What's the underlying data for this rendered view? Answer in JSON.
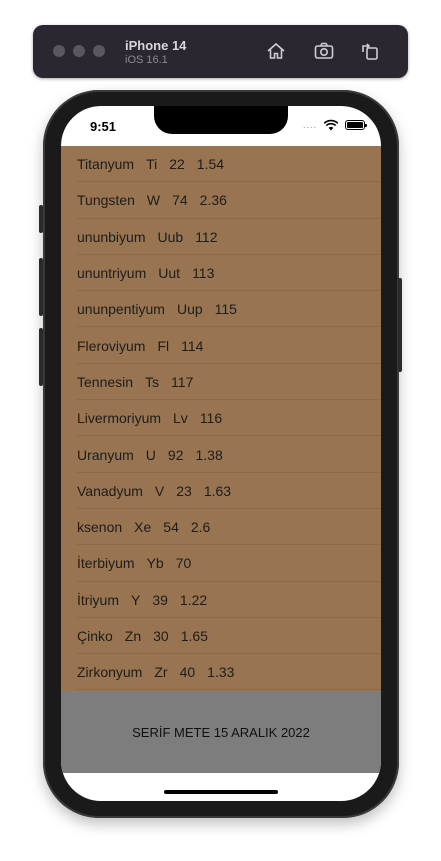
{
  "simulator": {
    "device_name": "iPhone 14",
    "os_version": "iOS 16.1",
    "icons": [
      "home-icon",
      "screenshot-icon",
      "rotate-icon"
    ]
  },
  "status_bar": {
    "time": "9:51",
    "signal_dots": "....",
    "icons": [
      "wifi-icon",
      "battery-icon"
    ]
  },
  "elements": [
    {
      "name": "Titanyum",
      "symbol": "Ti",
      "number": "22",
      "value": "1.54"
    },
    {
      "name": "Tungsten",
      "symbol": "W",
      "number": "74",
      "value": "2.36"
    },
    {
      "name": "ununbiyum",
      "symbol": "Uub",
      "number": "112",
      "value": ""
    },
    {
      "name": "ununtriyum",
      "symbol": "Uut",
      "number": "113",
      "value": ""
    },
    {
      "name": "ununpentiyum",
      "symbol": "Uup",
      "number": "115",
      "value": ""
    },
    {
      "name": "Fleroviyum",
      "symbol": "Fl",
      "number": "114",
      "value": ""
    },
    {
      "name": "Tennesin",
      "symbol": "Ts",
      "number": "117",
      "value": ""
    },
    {
      "name": "Livermoriyum",
      "symbol": "Lv",
      "number": "116",
      "value": ""
    },
    {
      "name": "Uranyum",
      "symbol": "U",
      "number": "92",
      "value": "1.38"
    },
    {
      "name": "Vanadyum",
      "symbol": "V",
      "number": "23",
      "value": "1.63"
    },
    {
      "name": "ksenon",
      "symbol": "Xe",
      "number": "54",
      "value": "2.6"
    },
    {
      "name": "İterbiyum",
      "symbol": "Yb",
      "number": "70",
      "value": ""
    },
    {
      "name": "İtriyum",
      "symbol": "Y",
      "number": "39",
      "value": "1.22"
    },
    {
      "name": "Çinko",
      "symbol": "Zn",
      "number": "30",
      "value": "1.65"
    },
    {
      "name": "Zirkonyum",
      "symbol": "Zr",
      "number": "40",
      "value": "1.33"
    }
  ],
  "footer": {
    "text": "SERİF METE 15 ARALIK 2022"
  },
  "colors": {
    "list_background": "#987550",
    "footer_background": "#7d7d7d",
    "toolbar_background": "#2b2630"
  }
}
